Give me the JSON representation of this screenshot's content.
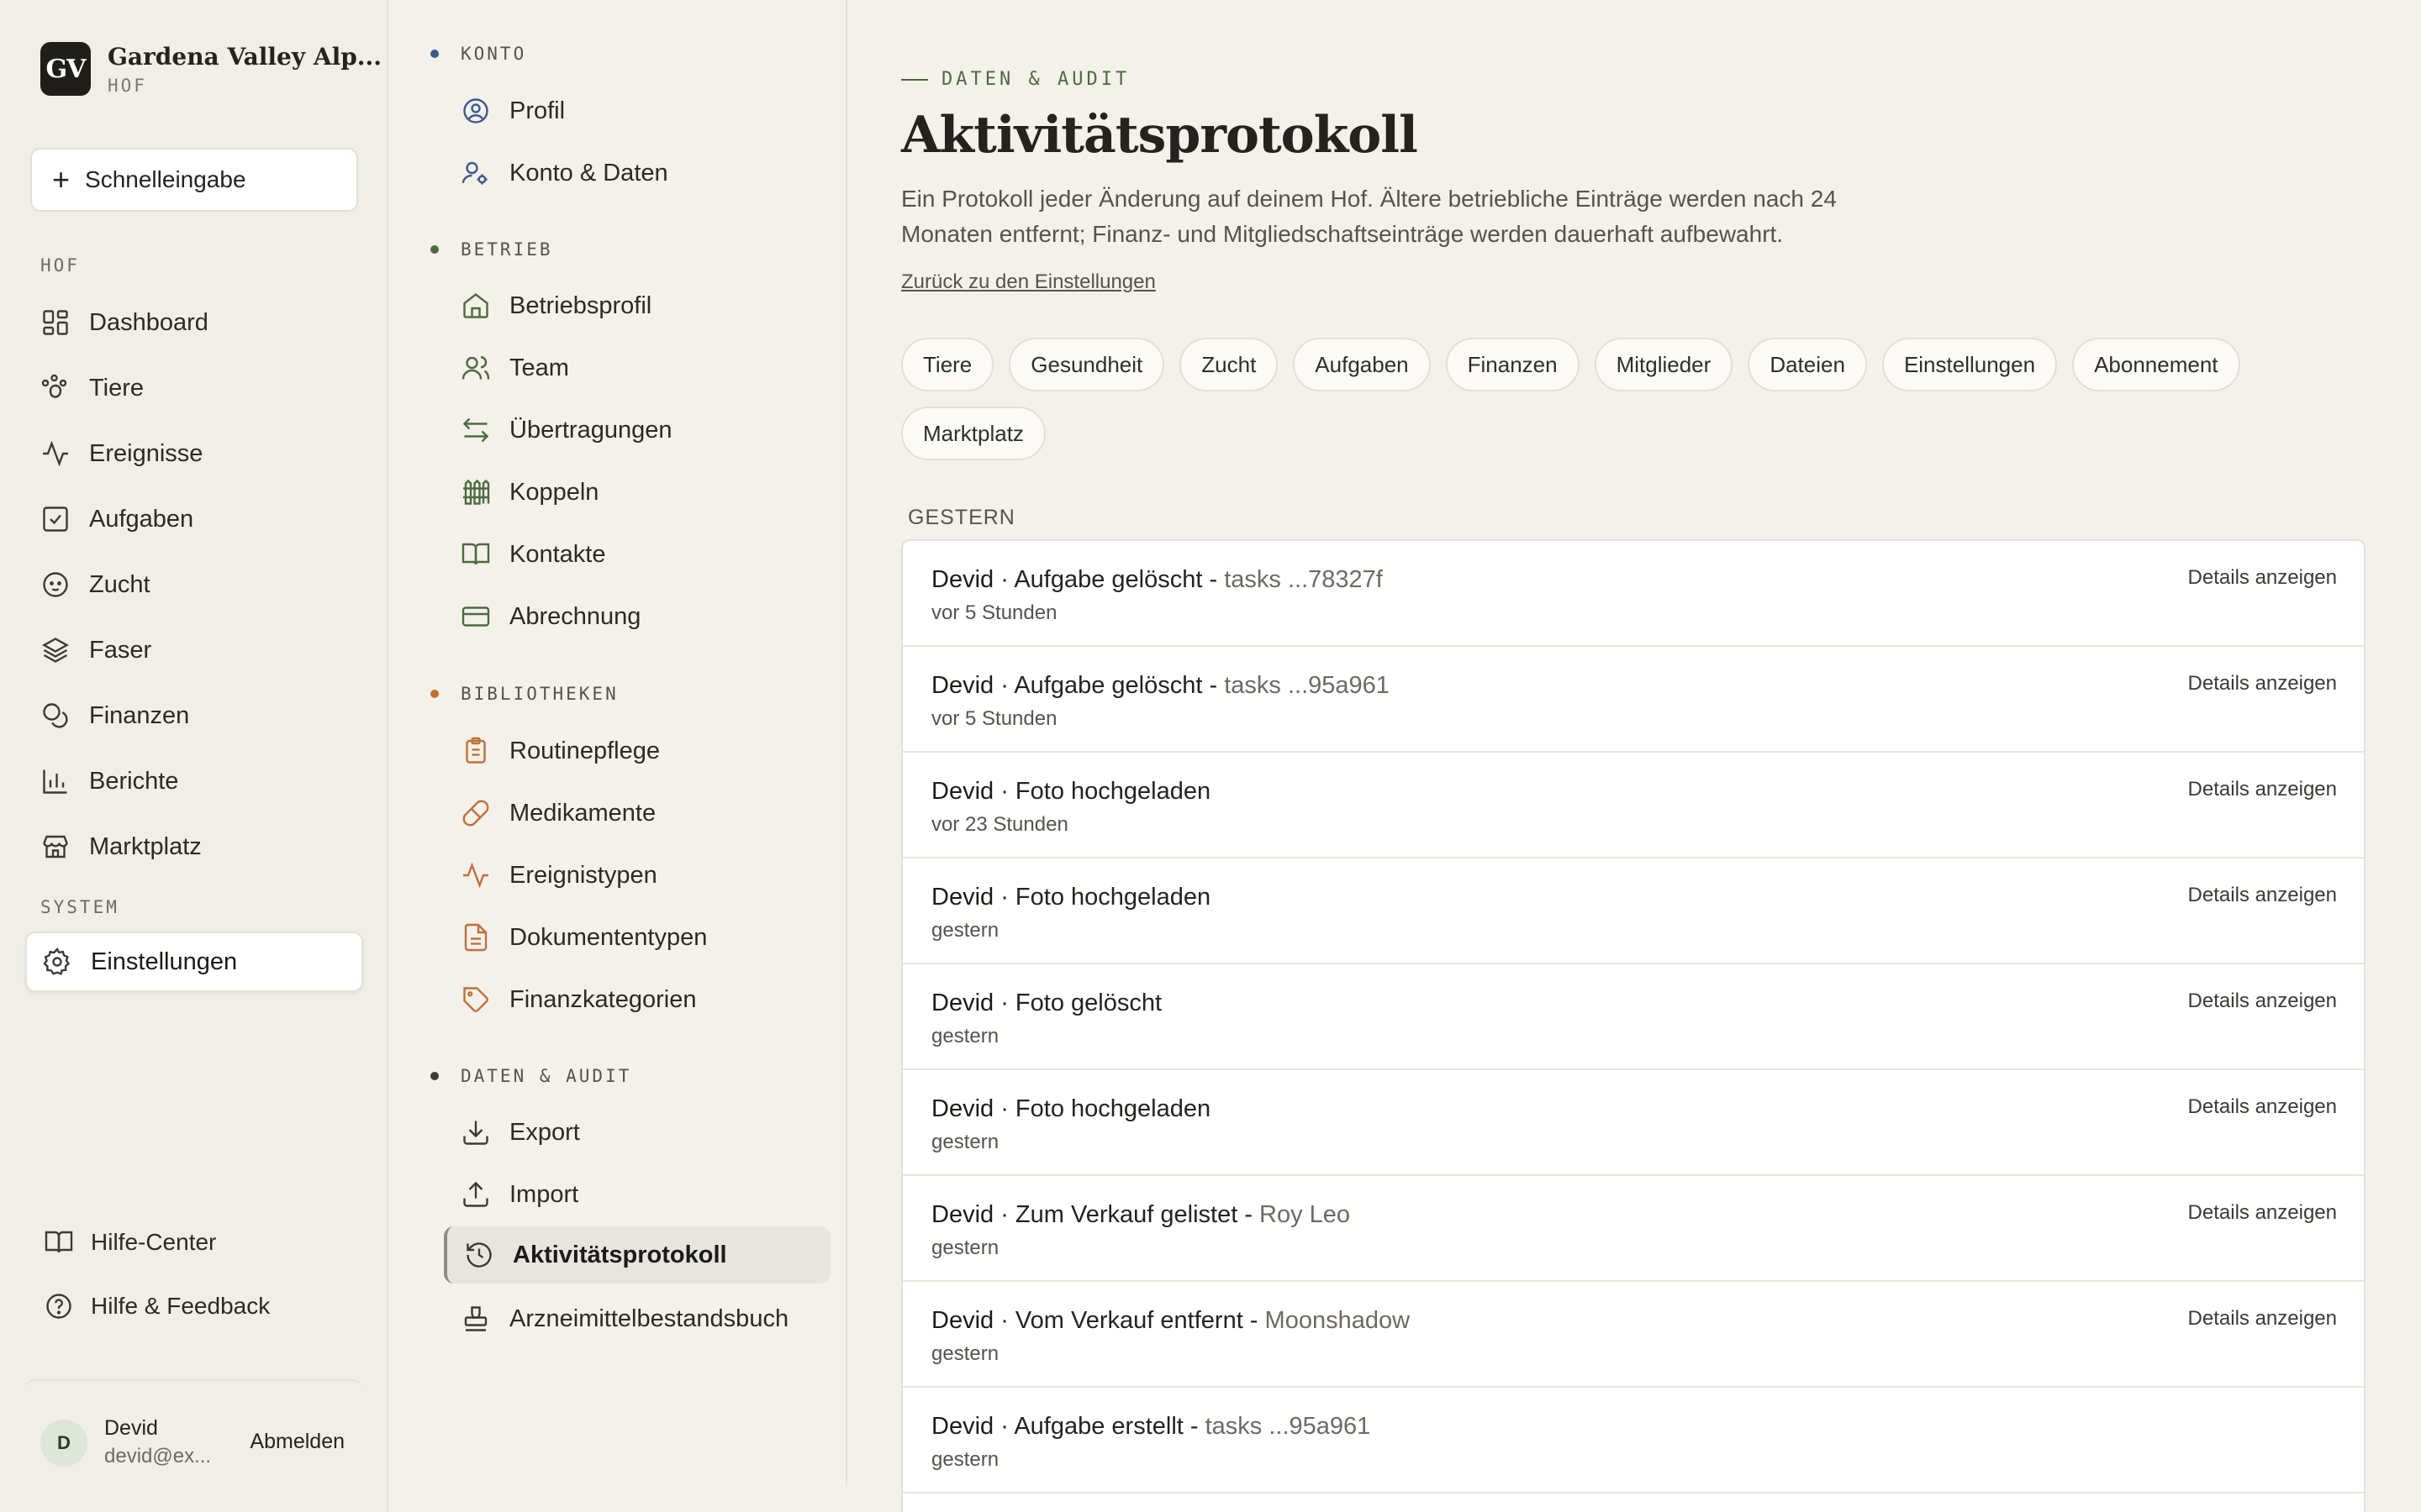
{
  "brand": {
    "logo": "GV",
    "name": "Gardena Valley Alp...",
    "sub": "HOF"
  },
  "quick_entry": {
    "label": "Schnelleingabe"
  },
  "sidebar": {
    "section_hof": "HOF",
    "items": [
      {
        "label": "Dashboard",
        "icon": "dashboard-icon"
      },
      {
        "label": "Tiere",
        "icon": "paw-icon"
      },
      {
        "label": "Ereignisse",
        "icon": "activity-icon"
      },
      {
        "label": "Aufgaben",
        "icon": "checkbox-icon"
      },
      {
        "label": "Zucht",
        "icon": "baby-icon"
      },
      {
        "label": "Faser",
        "icon": "layers-icon"
      },
      {
        "label": "Finanzen",
        "icon": "coins-icon"
      },
      {
        "label": "Berichte",
        "icon": "bar-chart-icon"
      },
      {
        "label": "Marktplatz",
        "icon": "store-icon"
      }
    ],
    "section_system": "SYSTEM",
    "settings": {
      "label": "Einstellungen",
      "icon": "gear-icon"
    },
    "help_center": "Hilfe-Center",
    "help_feedback": "Hilfe & Feedback"
  },
  "user": {
    "initial": "D",
    "name": "Devid",
    "email": "devid@ex...",
    "logout": "Abmelden"
  },
  "subnav": {
    "konto": {
      "title": "KONTO",
      "items": [
        "Profil",
        "Konto & Daten"
      ]
    },
    "betrieb": {
      "title": "BETRIEB",
      "items": [
        "Betriebsprofil",
        "Team",
        "Übertragungen",
        "Koppeln",
        "Kontakte",
        "Abrechnung"
      ]
    },
    "bibliotheken": {
      "title": "BIBLIOTHEKEN",
      "items": [
        "Routinepflege",
        "Medikamente",
        "Ereignistypen",
        "Dokumententypen",
        "Finanzkategorien"
      ]
    },
    "audit": {
      "title": "DATEN & AUDIT",
      "items": [
        "Export",
        "Import",
        "Aktivitätsprotokoll",
        "Arzneimittelbestandsbuch"
      ]
    }
  },
  "colors": {
    "konto_dot": "#3d5a8c",
    "betrieb_dot": "#4d6b3f",
    "bibliotheken_dot": "#c0703a",
    "audit_dot": "#3b3a35"
  },
  "main": {
    "eyebrow": "DATEN & AUDIT",
    "title": "Aktivitätsprotokoll",
    "description": "Ein Protokoll jeder Änderung auf deinem Hof. Ältere betriebliche Einträge werden nach 24 Monaten entfernt; Finanz- und Mitgliedschaftseinträge werden dauerhaft aufbewahrt.",
    "back_link": "Zurück zu den Einstellungen",
    "filters": [
      "Tiere",
      "Gesundheit",
      "Zucht",
      "Aufgaben",
      "Finanzen",
      "Mitglieder",
      "Dateien",
      "Einstellungen",
      "Abonnement",
      "Marktplatz"
    ],
    "group_label": "GESTERN",
    "details_label": "Details anzeigen",
    "entries": [
      {
        "actor": "Devid",
        "action": " · Aufgabe gelöscht - ",
        "target": "tasks ...78327f",
        "time": "vor 5 Stunden"
      },
      {
        "actor": "Devid",
        "action": " · Aufgabe gelöscht - ",
        "target": "tasks ...95a961",
        "time": "vor 5 Stunden"
      },
      {
        "actor": "Devid",
        "action": " · Foto hochgeladen",
        "target": "",
        "time": "vor 23 Stunden"
      },
      {
        "actor": "Devid",
        "action": " · Foto hochgeladen",
        "target": "",
        "time": "gestern"
      },
      {
        "actor": "Devid",
        "action": " · Foto gelöscht",
        "target": "",
        "time": "gestern"
      },
      {
        "actor": "Devid",
        "action": " · Foto hochgeladen",
        "target": "",
        "time": "gestern"
      },
      {
        "actor": "Devid",
        "action": " · Zum Verkauf gelistet - ",
        "target": "Roy Leo",
        "time": "gestern"
      },
      {
        "actor": "Devid",
        "action": " · Vom Verkauf entfernt - ",
        "target": "Moonshadow",
        "time": "gestern"
      },
      {
        "actor": "Devid",
        "action": " · Aufgabe erstellt - ",
        "target": "tasks ...95a961",
        "time": "gestern"
      }
    ]
  }
}
